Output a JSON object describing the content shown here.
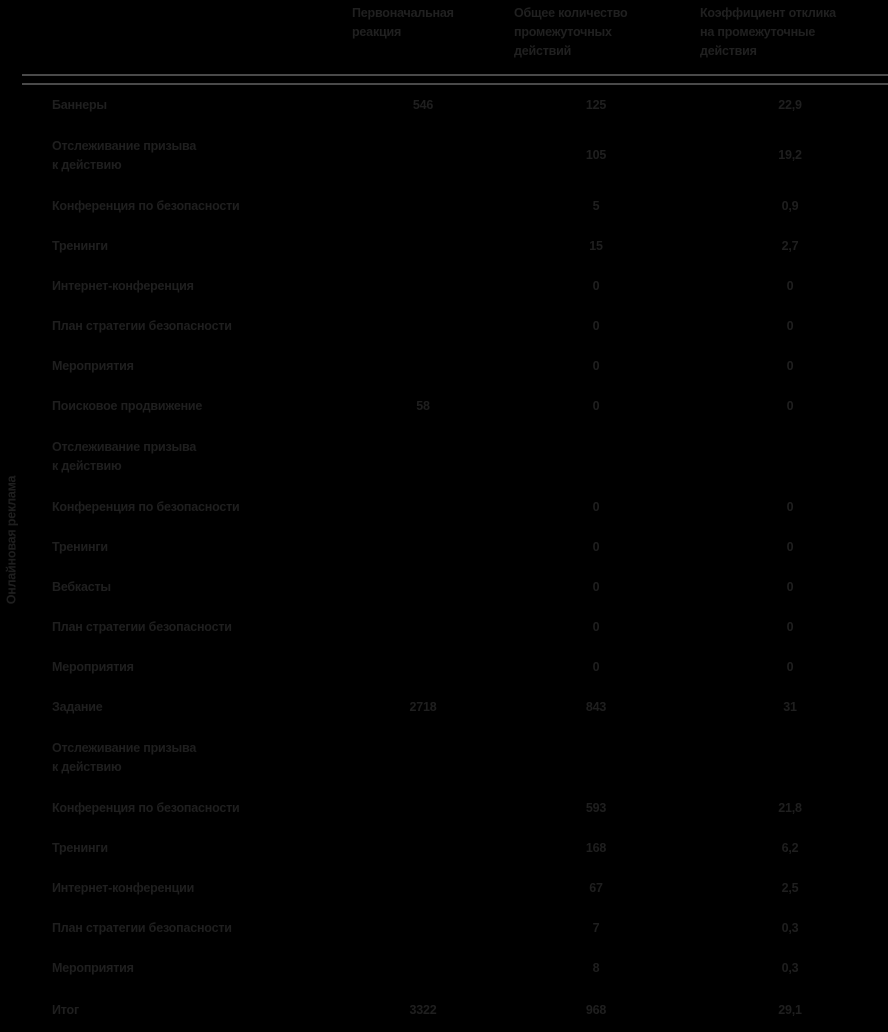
{
  "side_label": "Онлайновая реклама",
  "columns": {
    "label": "",
    "initial_response": "Первоначальная реакция",
    "total_intermediate": "Общее количество промежуточных действий",
    "response_rate": "Коэффициент отклика на промежуточные действия"
  },
  "column_lines": {
    "initial_response": [
      "Первоначальная",
      "реакция"
    ],
    "total_intermediate": [
      "Общее количество",
      "промежуточных",
      "действий"
    ],
    "response_rate": [
      "Коэффициент отклика",
      "на промежуточные",
      "действия"
    ]
  },
  "rows": [
    {
      "label": "Баннеры",
      "label2": "",
      "initial": "546",
      "total": "125",
      "rate": "22,9"
    },
    {
      "label": "Отслеживание призыва",
      "label2": "к действию",
      "initial": "",
      "total": "105",
      "rate": "19,2"
    },
    {
      "label": "Конференция по безопасности",
      "label2": "",
      "initial": "",
      "total": "5",
      "rate": "0,9"
    },
    {
      "label": "Тренинги",
      "label2": "",
      "initial": "",
      "total": "15",
      "rate": "2,7"
    },
    {
      "label": "Интернет-конференция",
      "label2": "",
      "initial": "",
      "total": "0",
      "rate": "0"
    },
    {
      "label": "План стратегии безопасности",
      "label2": "",
      "initial": "",
      "total": "0",
      "rate": "0"
    },
    {
      "label": "Мероприятия",
      "label2": "",
      "initial": "",
      "total": "0",
      "rate": "0"
    },
    {
      "label": "Поисковое продвижение",
      "label2": "",
      "initial": "58",
      "total": "0",
      "rate": "0"
    },
    {
      "label": "Отслеживание призыва",
      "label2": "к действию",
      "initial": "",
      "total": "",
      "rate": ""
    },
    {
      "label": "Конференция по безопасности",
      "label2": "",
      "initial": "",
      "total": "0",
      "rate": "0"
    },
    {
      "label": "Тренинги",
      "label2": "",
      "initial": "",
      "total": "0",
      "rate": "0"
    },
    {
      "label": "Вебкасты",
      "label2": "",
      "initial": "",
      "total": "0",
      "rate": "0"
    },
    {
      "label": "План стратегии безопасности",
      "label2": "",
      "initial": "",
      "total": "0",
      "rate": "0"
    },
    {
      "label": "Мероприятия",
      "label2": "",
      "initial": "",
      "total": "0",
      "rate": "0"
    },
    {
      "label": "Задание",
      "label2": "",
      "initial": "2718",
      "total": "843",
      "rate": "31"
    },
    {
      "label": "Отслеживание призыва",
      "label2": "к действию",
      "initial": "",
      "total": "",
      "rate": ""
    },
    {
      "label": "Конференция по безопасности",
      "label2": "",
      "initial": "",
      "total": "593",
      "rate": "21,8"
    },
    {
      "label": "Тренинги",
      "label2": "",
      "initial": "",
      "total": "168",
      "rate": "6,2"
    },
    {
      "label": "Интернет-конференции",
      "label2": "",
      "initial": "",
      "total": "67",
      "rate": "2,5"
    },
    {
      "label": "План стратегии безопасности",
      "label2": "",
      "initial": "",
      "total": "7",
      "rate": "0,3"
    },
    {
      "label": "Мероприятия",
      "label2": "",
      "initial": "",
      "total": "8",
      "rate": "0,3"
    },
    {
      "label": "Итог",
      "label2": "",
      "initial": "3322",
      "total": "968",
      "rate": "29,1"
    }
  ],
  "chart_data": {
    "type": "table",
    "title": "Онлайновая реклама",
    "columns": [
      "",
      "Первоначальная реакция",
      "Общее количество промежуточных действий",
      "Коэффициент отклика на промежуточные действия"
    ],
    "rows": [
      [
        "Баннеры",
        546,
        125,
        22.9
      ],
      [
        "Отслеживание призыва к действию",
        null,
        105,
        19.2
      ],
      [
        "Конференция по безопасности",
        null,
        5,
        0.9
      ],
      [
        "Тренинги",
        null,
        15,
        2.7
      ],
      [
        "Интернет-конференция",
        null,
        0,
        0
      ],
      [
        "План стратегии безопасности",
        null,
        0,
        0
      ],
      [
        "Мероприятия",
        null,
        0,
        0
      ],
      [
        "Поисковое продвижение",
        58,
        0,
        0
      ],
      [
        "Отслеживание призыва к действию",
        null,
        null,
        null
      ],
      [
        "Конференция по безопасности",
        null,
        0,
        0
      ],
      [
        "Тренинги",
        null,
        0,
        0
      ],
      [
        "Вебкасты",
        null,
        0,
        0
      ],
      [
        "План стратегии безопасности",
        null,
        0,
        0
      ],
      [
        "Мероприятия",
        null,
        0,
        0
      ],
      [
        "Задание",
        2718,
        843,
        31
      ],
      [
        "Отслеживание призыва к действию",
        null,
        null,
        null
      ],
      [
        "Конференция по безопасности",
        null,
        593,
        21.8
      ],
      [
        "Тренинги",
        null,
        168,
        6.2
      ],
      [
        "Интернет-конференции",
        null,
        67,
        2.5
      ],
      [
        "План стратегии безопасности",
        null,
        7,
        0.3
      ],
      [
        "Мероприятия",
        null,
        8,
        0.3
      ],
      [
        "Итог",
        3322,
        968,
        29.1
      ]
    ]
  }
}
